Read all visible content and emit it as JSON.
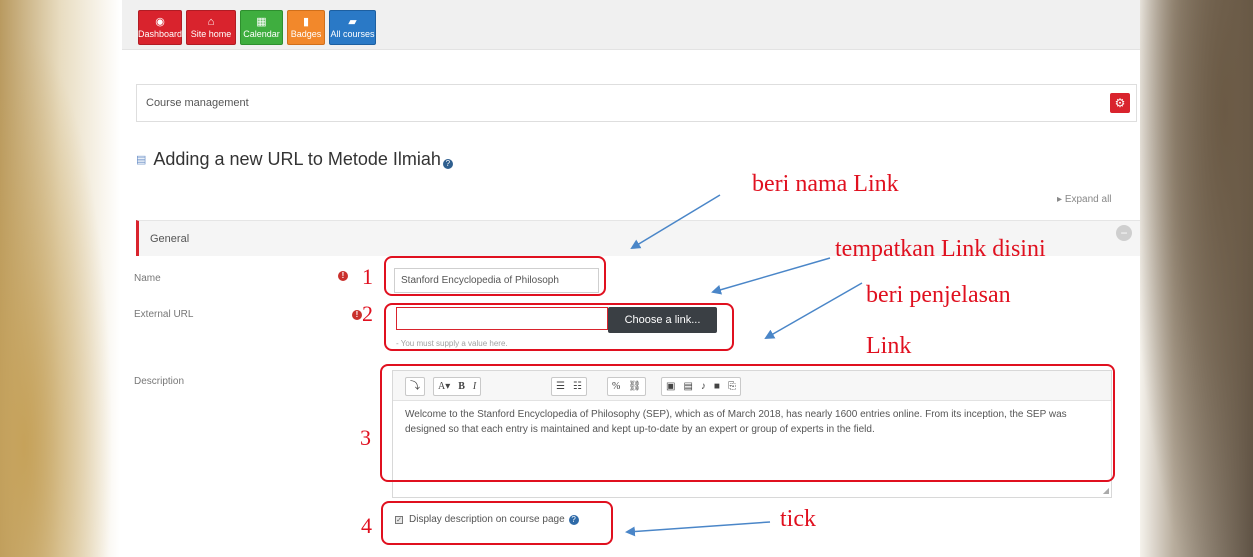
{
  "nav": [
    {
      "label": "Dashboard",
      "icon": "dashboard-icon",
      "color": "red"
    },
    {
      "label": "Site home",
      "icon": "home-icon",
      "color": "red"
    },
    {
      "label": "Calendar",
      "icon": "calendar-icon",
      "color": "green"
    },
    {
      "label": "Badges",
      "icon": "badge-icon",
      "color": "orange"
    },
    {
      "label": "All courses",
      "icon": "courses-icon",
      "color": "blue"
    }
  ],
  "course_management": {
    "label": "Course management"
  },
  "page_title": "Adding a new URL to Metode Ilmiah",
  "expand_all": "Expand all",
  "section": {
    "label": "General"
  },
  "form": {
    "name_label": "Name",
    "name_value": "Stanford Encyclopedia of Philosoph",
    "url_label": "External URL",
    "url_value": "",
    "choose_link": "Choose a link...",
    "url_error": "- You must supply a value here.",
    "description_label": "Description",
    "description_text": "Welcome to the Stanford Encyclopedia of Philosophy (SEP), which as of March 2018, has nearly 1600 entries online. From its inception, the SEP was designed so that each entry is maintained and kept up-to-date by an expert or group of experts in the field.",
    "display_desc_label": "Display description on course page",
    "display_desc_checked": true
  },
  "toolbar": {
    "toggle": "⤵",
    "font": "A▾",
    "bold": "B",
    "italic": "I",
    "ul": "☰",
    "ol": "☷",
    "link": "%",
    "unlink": "⛓",
    "image": "▣",
    "media": "▤",
    "audio": "♪",
    "video": "■",
    "copy": "⎘"
  },
  "annotations": {
    "n1": "1",
    "n2": "2",
    "n3": "3",
    "n4": "4",
    "name_hint": "beri nama Link",
    "url_hint": "tempatkan Link disini",
    "desc_hint_1": "beri   penjelasan",
    "desc_hint_2": "Link",
    "tick_hint": "tick"
  },
  "colors": {
    "accent_red": "#d9232d",
    "annotation_red": "#e0101f",
    "arrow_blue": "#4a86c8"
  }
}
